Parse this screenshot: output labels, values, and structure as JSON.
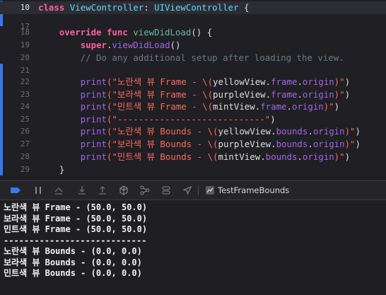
{
  "editor": {
    "lines": [
      {
        "num": "10",
        "tokens": [
          [
            "kw",
            "class "
          ],
          [
            "cls",
            "ViewController"
          ],
          [
            "ident",
            ": "
          ],
          [
            "cls",
            "UIViewController"
          ],
          [
            "ident",
            " {"
          ]
        ]
      },
      {
        "num": "17",
        "tokens": []
      },
      {
        "num": "18",
        "tokens": [
          [
            "ident",
            "    "
          ],
          [
            "kw",
            "override func "
          ],
          [
            "fn",
            "viewDidLoad"
          ],
          [
            "ident",
            "() {"
          ]
        ]
      },
      {
        "num": "19",
        "tokens": [
          [
            "ident",
            "        "
          ],
          [
            "kw",
            "super"
          ],
          [
            "ident",
            "."
          ],
          [
            "prop",
            "viewDidLoad"
          ],
          [
            "ident",
            "()"
          ]
        ]
      },
      {
        "num": "20",
        "tokens": [
          [
            "cmt",
            "        // Do any additional setup after loading the view."
          ]
        ]
      },
      {
        "num": "21",
        "tokens": []
      },
      {
        "num": "22",
        "tokens": [
          [
            "ident",
            "        "
          ],
          [
            "prop",
            "print"
          ],
          [
            "str",
            "(\"노란색 뷰 Frame - \\("
          ],
          [
            "ident",
            "yellowView"
          ],
          [
            "ident",
            "."
          ],
          [
            "prop",
            "frame"
          ],
          [
            "ident",
            "."
          ],
          [
            "prop",
            "origin"
          ],
          [
            "str",
            ")\""
          ],
          [
            "ident",
            ")"
          ]
        ]
      },
      {
        "num": "23",
        "tokens": [
          [
            "ident",
            "        "
          ],
          [
            "prop",
            "print"
          ],
          [
            "str",
            "(\"보라색 뷰 Frame - \\("
          ],
          [
            "ident",
            "purpleView"
          ],
          [
            "ident",
            "."
          ],
          [
            "prop",
            "frame"
          ],
          [
            "ident",
            "."
          ],
          [
            "prop",
            "origin"
          ],
          [
            "str",
            ")\""
          ],
          [
            "ident",
            ")"
          ]
        ]
      },
      {
        "num": "24",
        "tokens": [
          [
            "ident",
            "        "
          ],
          [
            "prop",
            "print"
          ],
          [
            "str",
            "(\"민트색 뷰 Frame - \\("
          ],
          [
            "ident",
            "mintView"
          ],
          [
            "ident",
            "."
          ],
          [
            "prop",
            "frame"
          ],
          [
            "ident",
            "."
          ],
          [
            "prop",
            "origin"
          ],
          [
            "str",
            ")\""
          ],
          [
            "ident",
            ")"
          ]
        ]
      },
      {
        "num": "25",
        "tokens": [
          [
            "ident",
            "        "
          ],
          [
            "prop",
            "print"
          ],
          [
            "str",
            "(\"----------------------------\""
          ],
          [
            "ident",
            ")"
          ]
        ]
      },
      {
        "num": "26",
        "tokens": [
          [
            "ident",
            "        "
          ],
          [
            "prop",
            "print"
          ],
          [
            "str",
            "(\"노란색 뷰 Bounds - \\("
          ],
          [
            "ident",
            "yellowView"
          ],
          [
            "ident",
            "."
          ],
          [
            "prop",
            "bounds"
          ],
          [
            "ident",
            "."
          ],
          [
            "prop",
            "origin"
          ],
          [
            "str",
            ")\""
          ],
          [
            "ident",
            ")"
          ]
        ]
      },
      {
        "num": "27",
        "tokens": [
          [
            "ident",
            "        "
          ],
          [
            "prop",
            "print"
          ],
          [
            "str",
            "(\"보라색 뷰 Bounds - \\("
          ],
          [
            "ident",
            "purpleView"
          ],
          [
            "ident",
            "."
          ],
          [
            "prop",
            "bounds"
          ],
          [
            "ident",
            "."
          ],
          [
            "prop",
            "origin"
          ],
          [
            "str",
            ")\""
          ],
          [
            "ident",
            ")"
          ]
        ]
      },
      {
        "num": "28",
        "tokens": [
          [
            "ident",
            "        "
          ],
          [
            "prop",
            "print"
          ],
          [
            "str",
            "(\"민트색 뷰 Bounds - \\("
          ],
          [
            "ident",
            "mintView"
          ],
          [
            "ident",
            "."
          ],
          [
            "prop",
            "bounds"
          ],
          [
            "ident",
            "."
          ],
          [
            "prop",
            "origin"
          ],
          [
            "str",
            ")\""
          ],
          [
            "ident",
            ")"
          ]
        ]
      },
      {
        "num": "29",
        "tokens": [
          [
            "ident",
            "    }"
          ]
        ]
      }
    ],
    "current_line": "10"
  },
  "debug_bar": {
    "target_name": "TestFrameBounds",
    "icons": [
      "breakpoints-toggle-icon",
      "pause-icon",
      "step-over-icon",
      "step-into-icon",
      "step-out-icon",
      "debug-view-hierarchy-icon",
      "memory-graph-icon",
      "environment-overrides-icon",
      "simulate-location-icon",
      "scheme-target-icon"
    ]
  },
  "console": {
    "output": [
      "노란색 뷰 Frame - (50.0, 50.0)",
      "보라색 뷰 Frame - (50.0, 50.0)",
      "민트색 뷰 Frame - (50.0, 50.0)",
      "----------------------------",
      "노란색 뷰 Bounds - (0.0, 0.0)",
      "보라색 뷰 Bounds - (0.0, 0.0)",
      "민트색 뷰 Bounds - (0.0, 0.0)"
    ]
  },
  "colors": {
    "accent": "#3b77e7",
    "keyword": "#fc5fa3",
    "type": "#5dd8ff",
    "string": "#fc6a5d",
    "property": "#a167e6",
    "comment": "#6c7986"
  }
}
